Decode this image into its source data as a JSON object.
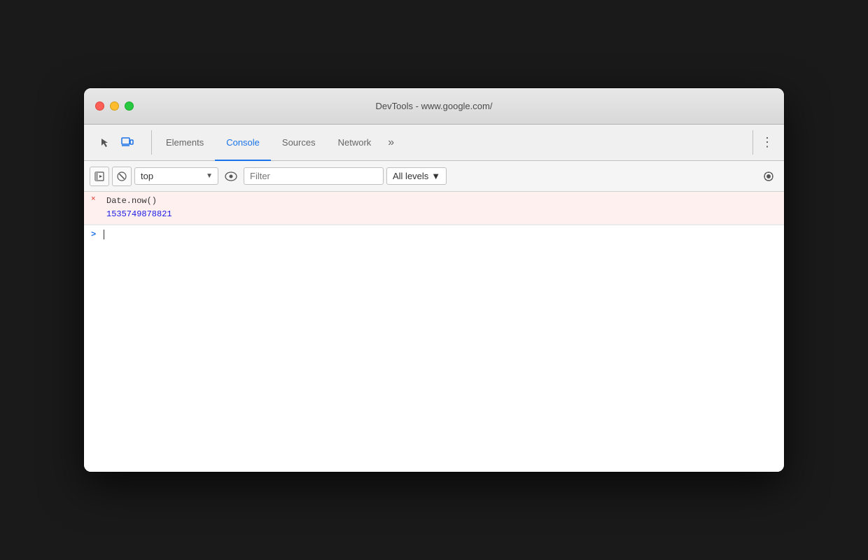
{
  "window": {
    "title": "DevTools - www.google.com/"
  },
  "traffic_lights": {
    "close_label": "close",
    "minimize_label": "minimize",
    "maximize_label": "maximize"
  },
  "tabs_bar": {
    "inspect_icon": "☰",
    "device_icon": "▣",
    "tabs": [
      {
        "id": "elements",
        "label": "Elements",
        "active": false
      },
      {
        "id": "console",
        "label": "Console",
        "active": true
      },
      {
        "id": "sources",
        "label": "Sources",
        "active": false
      },
      {
        "id": "network",
        "label": "Network",
        "active": false
      }
    ],
    "more_label": "»",
    "menu_label": "⋮"
  },
  "console_toolbar": {
    "sidebar_icon": "▶",
    "clear_icon": "⊘",
    "context_select": {
      "value": "top",
      "options": [
        "top"
      ]
    },
    "filter_placeholder": "Filter",
    "eye_icon": "👁",
    "levels_label": "All levels",
    "settings_icon": "⚙"
  },
  "console_output": [
    {
      "type": "input",
      "prefix": "×",
      "text": "Date.now()",
      "value": "1535749878821"
    }
  ],
  "console_input": {
    "chevron": ">",
    "value": ""
  }
}
